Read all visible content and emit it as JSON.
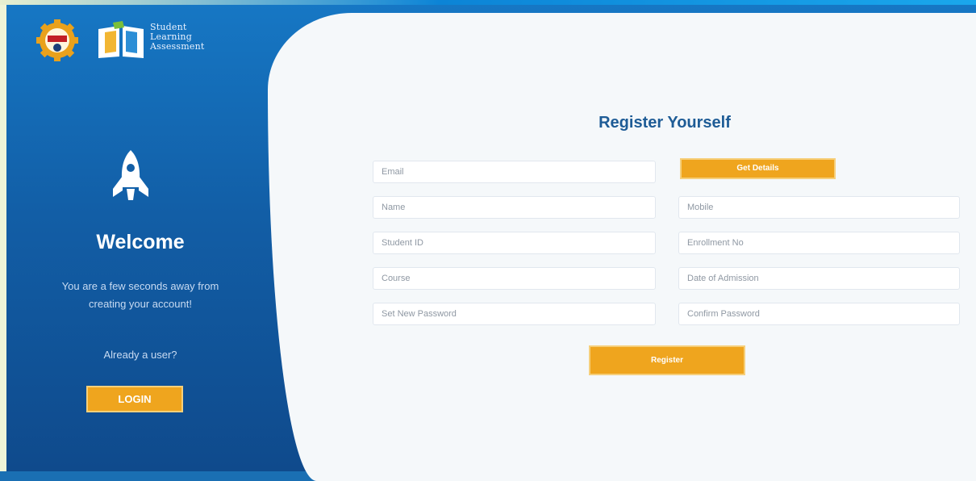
{
  "branding": {
    "logo_line1": "Student",
    "logo_line2": "Learning",
    "logo_line3": "Assessment"
  },
  "sidebar": {
    "welcome": "Welcome",
    "subtitle_line1": "You are a few seconds away from",
    "subtitle_line2": "creating your account!",
    "already_user": "Already a user?",
    "login_label": "LOGIN"
  },
  "form": {
    "title": "Register Yourself",
    "email_placeholder": "Email",
    "get_details_label": "Get Details",
    "name_placeholder": "Name",
    "mobile_placeholder": "Mobile",
    "student_id_placeholder": "Student ID",
    "enrollment_placeholder": "Enrollment No",
    "course_placeholder": "Course",
    "admission_placeholder": "Date of Admission",
    "new_password_placeholder": "Set New Password",
    "confirm_password_placeholder": "Confirm Password",
    "register_label": "Register"
  },
  "colors": {
    "accent": "#efa51e",
    "sidebar": "#125ea6",
    "title": "#1e5c96"
  },
  "icons": [
    "gear-logo-icon",
    "book-logo-icon",
    "rocket-icon"
  ]
}
